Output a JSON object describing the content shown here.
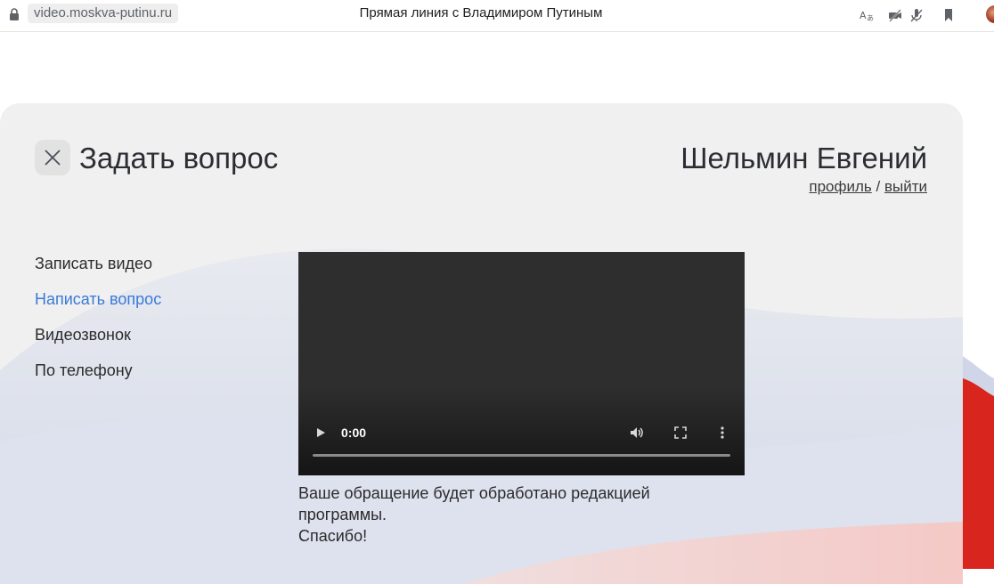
{
  "browser": {
    "url": "video.moskva-putinu.ru",
    "tab_title": "Прямая линия с Владимиром Путиным",
    "icons": [
      "translate-icon",
      "video-off-icon",
      "mic-off-icon",
      "bookmark-icon"
    ]
  },
  "header": {
    "title": "Задать вопрос",
    "user_name": "Шельмин Евгений",
    "profile_link": "профиль",
    "separator": "/",
    "logout_link": "выйти"
  },
  "menu": {
    "items": [
      {
        "label": "Записать видео",
        "active": false
      },
      {
        "label": "Написать вопрос",
        "active": true
      },
      {
        "label": "Видеозвонок",
        "active": false
      },
      {
        "label": "По телефону",
        "active": false
      }
    ]
  },
  "video": {
    "time": "0:00",
    "progress": 0
  },
  "notice": {
    "line1": "Ваше обращение будет обработано редакцией программы.",
    "line2": "Спасибо!"
  },
  "colors": {
    "accent": "#3a7ad8",
    "card_bg": "#f0f0f0",
    "video_bg": "#2e2e2e"
  }
}
